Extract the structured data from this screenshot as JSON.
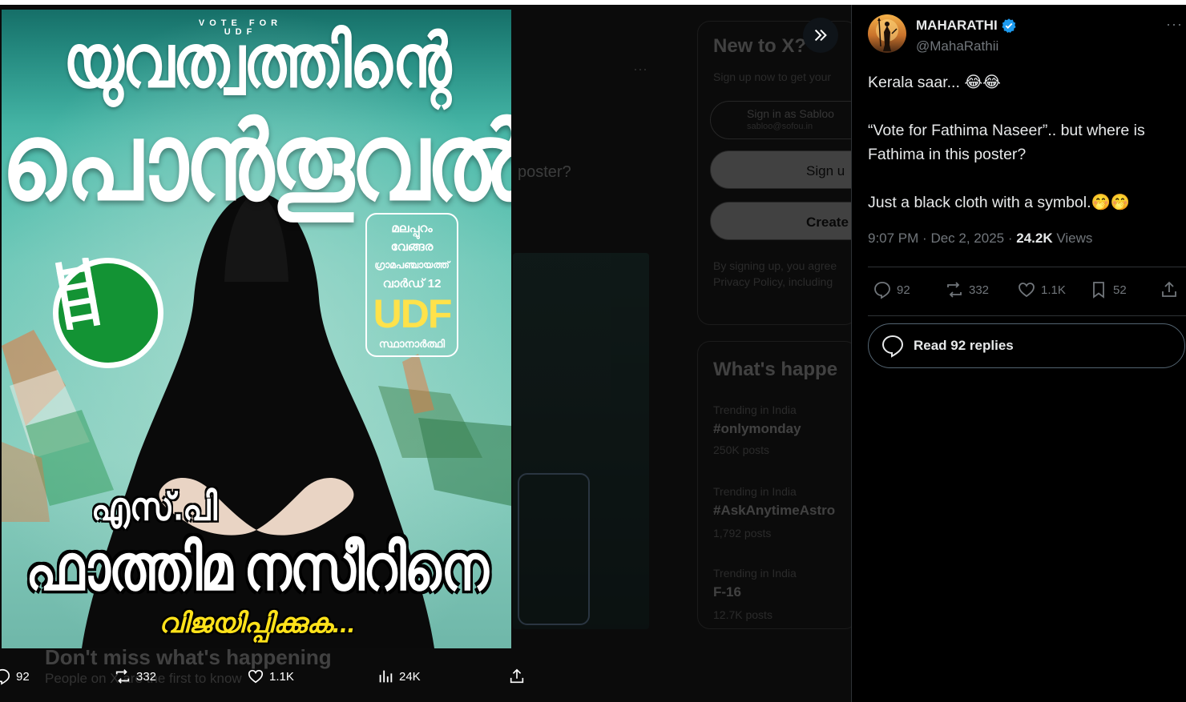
{
  "viewer": {
    "background": {
      "post_fragment": "poster?",
      "new_to_x": "New to X?",
      "signup_text": "Sign up now to get your",
      "sign_in_as": "Sign in as Sabloo",
      "sign_in_email": "sabloo@sofou.in",
      "sign_up_apple": "Sign u",
      "create_account": "Create",
      "terms": "By signing up, you agree",
      "privacy": "Privacy Policy, including",
      "whats_happening": "What's happe",
      "trends": [
        {
          "context": "Trending in India",
          "name": "#onlymonday",
          "posts": "250K posts"
        },
        {
          "context": "Trending in India",
          "name": "#AskAnytimeAstro",
          "posts": "1,792 posts"
        },
        {
          "context": "Trending in India",
          "name": "F-16",
          "posts": "12.7K posts"
        }
      ],
      "dont_miss": "Don't miss what's happening",
      "people_on": "People on X are the first to know"
    },
    "poster": {
      "vote_for": "VOTE FOR UDF",
      "headline_1": "യുവത്വത്തിന്റെ",
      "headline_2": "പൊൻതൂവൽ",
      "udf_box_lines": [
        "മലപ്പുറം",
        "വേങ്ങര",
        "ഗ്രാമപഞ്ചായത്ത്",
        "വാർഡ് 12"
      ],
      "udf_label": "UDF",
      "candidate_label": "സ്ഥാനാർത്ഥി",
      "prefix": "എസ്.പി",
      "candidate_name": "ഫാത്തിമ നസീറിനെ",
      "slogan": "വിജയിപ്പിക്കുക...",
      "symbol": "ladder-icon"
    },
    "actions": {
      "replies": "92",
      "reposts": "332",
      "likes": "1.1K",
      "views": "24K"
    }
  },
  "tweet": {
    "author_name": "MAHARATHI",
    "author_handle": "@MahaRathii",
    "paragraphs": [
      "Kerala saar... 😂😂",
      "“Vote for Fathima Naseer”.. but where is Fathima in this poster?",
      "Just a black cloth with a symbol.🤭🤭"
    ],
    "time": "9:07 PM",
    "date": "Dec 2, 2025",
    "views_count": "24.2K",
    "views_label": "Views",
    "replies": "92",
    "reposts": "332",
    "likes": "1.1K",
    "bookmarks": "52",
    "read_replies": "Read 92 replies"
  },
  "colors": {
    "accent": "#1d9bf0",
    "panel_bg": "#000000",
    "muted": "#71767b",
    "poster_teal": "#48b8a8",
    "party_green": "#139334",
    "slogan_yellow": "#ffe21a"
  }
}
